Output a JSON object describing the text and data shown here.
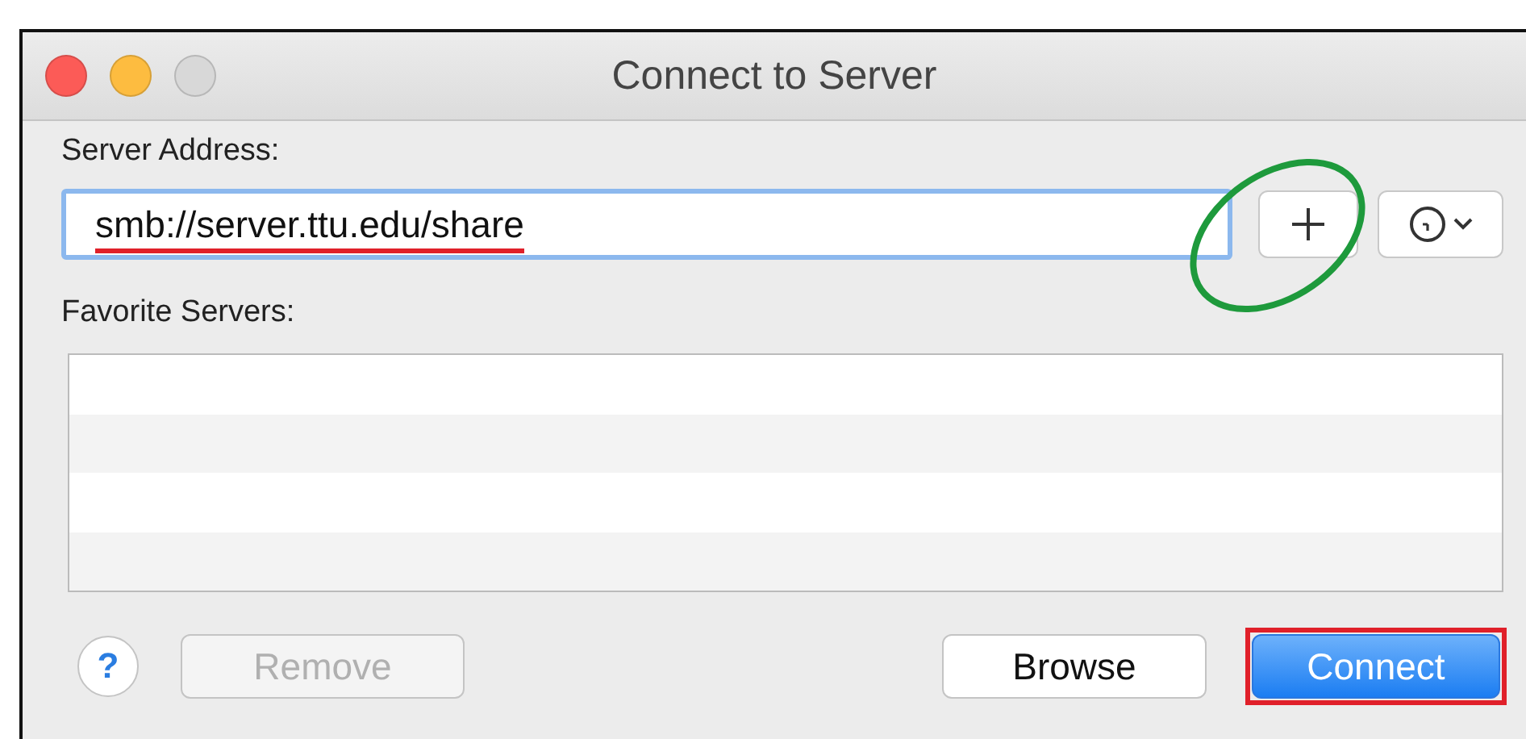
{
  "window": {
    "title": "Connect to Server",
    "traffic_lights": [
      {
        "kind": "close",
        "disabled": false
      },
      {
        "kind": "minimize",
        "disabled": false
      },
      {
        "kind": "zoom",
        "disabled": true
      }
    ]
  },
  "server_address": {
    "label": "Server Address:",
    "value": "smb://server.ttu.edu/share",
    "focused": true,
    "underlined": true
  },
  "add_button": {
    "circled": true
  },
  "favorite_servers": {
    "label": "Favorite Servers:"
  },
  "buttons": [
    {
      "kind": "help",
      "label": "?"
    },
    {
      "kind": "push",
      "label": "Remove",
      "disabled": true
    },
    {
      "kind": "push",
      "label": "Browse",
      "disabled": false
    },
    {
      "kind": "default",
      "label": "Connect",
      "framed": true
    }
  ]
}
